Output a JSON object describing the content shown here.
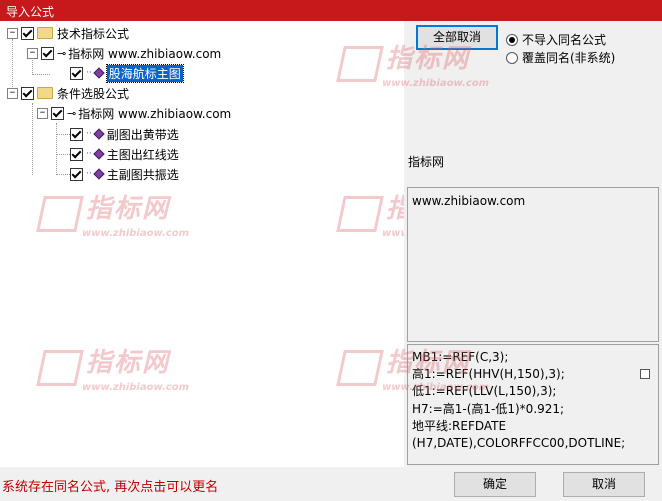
{
  "window": {
    "title": "导入公式"
  },
  "tree": {
    "root1": {
      "label": "技术指标公式"
    },
    "root1_child": {
      "label": "指标网 www.zhibiaow.com"
    },
    "root1_leaf": {
      "label": "股海航标主图"
    },
    "root2": {
      "label": "条件选股公式"
    },
    "root2_child": {
      "label": "指标网 www.zhibiaow.com"
    },
    "root2_leaves": [
      {
        "label": "副图出黄带选"
      },
      {
        "label": "主图出红线选"
      },
      {
        "label": "主副图共振选"
      }
    ]
  },
  "controls": {
    "cancel_all_label": "全部取消",
    "radio_no_import_label": "不导入同名公式",
    "radio_overwrite_label": "覆盖同名(非系统)"
  },
  "info": {
    "source_label": "指标网",
    "url": "www.zhibiaow.com"
  },
  "formula": {
    "text": "MB1:=REF(C,3);\n高1:=REF(HHV(H,150),3);\n低1:=REF(LLV(L,150),3);\nH7:=高1-(高1-低1)*0.921;\n地平线:REFDATE\n(H7,DATE),COLORFFCC00,DOTLINE;"
  },
  "watermark": {
    "big": "指标网",
    "small": "www.zhibiaow.com"
  },
  "status": {
    "text": "系统存在同名公式, 再次点击可以更名"
  },
  "buttons": {
    "ok_label": "确定",
    "cancel_label": "取消"
  },
  "colors": {
    "title_bar": "#c7181c",
    "selection": "#0a64c8",
    "status_text": "#c00000"
  }
}
